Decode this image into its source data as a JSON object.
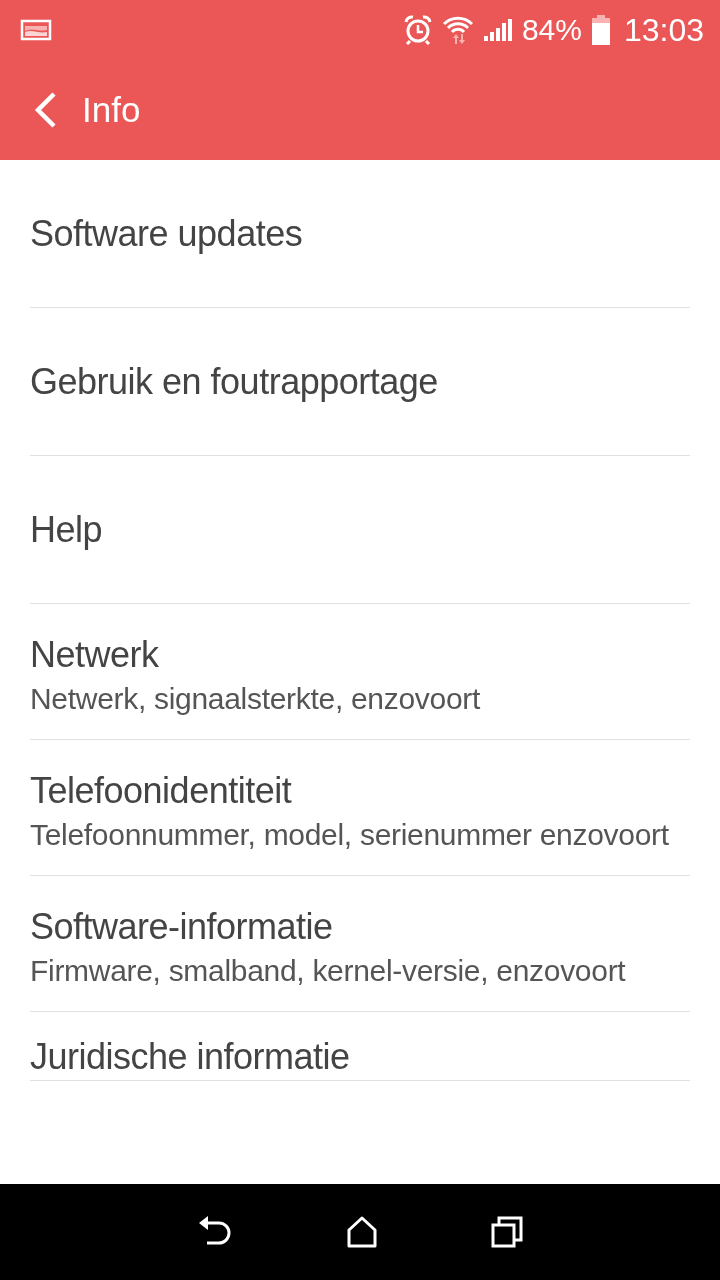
{
  "status_bar": {
    "battery": "84%",
    "time": "13:03"
  },
  "app_bar": {
    "title": "Info"
  },
  "items": [
    {
      "title": "Software updates"
    },
    {
      "title": "Gebruik en foutrapportage"
    },
    {
      "title": "Help"
    },
    {
      "title": "Netwerk",
      "subtitle": "Netwerk, signaalsterkte, enzovoort"
    },
    {
      "title": "Telefoonidentiteit",
      "subtitle": "Telefoonnummer, model, serienummer enzovoort"
    },
    {
      "title": "Software-informatie",
      "subtitle": "Firmware, smalband, kernel-versie, enzovoort"
    },
    {
      "title": "Juridische informatie"
    }
  ]
}
